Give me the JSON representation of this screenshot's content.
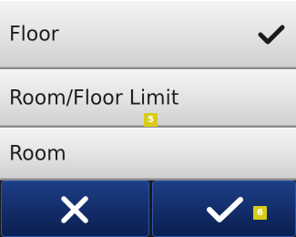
{
  "options": [
    {
      "label": "Floor",
      "selected": true
    },
    {
      "label": "Room/Floor Limit",
      "selected": false
    },
    {
      "label": "Room",
      "selected": false
    }
  ],
  "callouts": {
    "options_marker": "5",
    "confirm_marker": "6"
  },
  "buttons": {
    "cancel_icon": "x-icon",
    "confirm_icon": "checkmark-icon"
  },
  "colors": {
    "option_bg": "#e2e2e2",
    "button_bg": "#122c68",
    "badge": "#d8cc18",
    "icon": "#ffffff"
  }
}
